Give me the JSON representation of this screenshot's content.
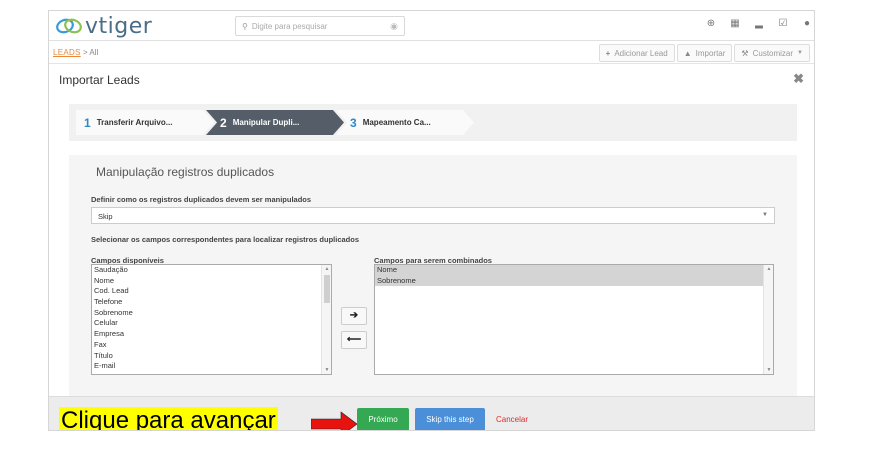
{
  "app": {
    "logo_text": "vtiger"
  },
  "search": {
    "placeholder": "Digite para pesquisar"
  },
  "breadcrumb": {
    "module": "LEADS",
    "separator": ">",
    "current": "All"
  },
  "toolbar": {
    "add_label": "Adicionar Lead",
    "import_label": "Importar",
    "customize_label": "Customizar"
  },
  "modal": {
    "title": "Importar Leads"
  },
  "wizard": {
    "steps": [
      {
        "num": "1",
        "label": "Transferir Arquivo..."
      },
      {
        "num": "2",
        "label": "Manipular Dupli..."
      },
      {
        "num": "3",
        "label": "Mapeamento Ca..."
      }
    ]
  },
  "duplicates": {
    "title": "Manipulação registros duplicados",
    "define_label": "Definir como os registros duplicados devem ser manipulados",
    "selected_option": "Skip",
    "select_fields_label": "Selecionar os campos correspondentes para localizar registros duplicados",
    "available_label": "Campos disponíveis",
    "merge_label": "Campos para serem combinados",
    "available_fields": [
      "Saudação",
      "Nome",
      "Cod. Lead",
      "Telefone",
      "Sobrenome",
      "Celular",
      "Empresa",
      "Fax",
      "Título",
      "E-mail"
    ],
    "merge_fields": [
      "Nome",
      "Sobrenome"
    ]
  },
  "footer": {
    "callout": "Clique para avançar",
    "next_label": "Próximo",
    "skip_label": "Skip this step",
    "cancel_label": "Cancelar"
  },
  "colors": {
    "accent_orange": "#e6893b",
    "next_green": "#35a853",
    "skip_blue": "#4a8fd8",
    "cancel_red": "#e02b2b",
    "callout_yellow": "#ffff00",
    "arrow_red": "#e8130f"
  }
}
